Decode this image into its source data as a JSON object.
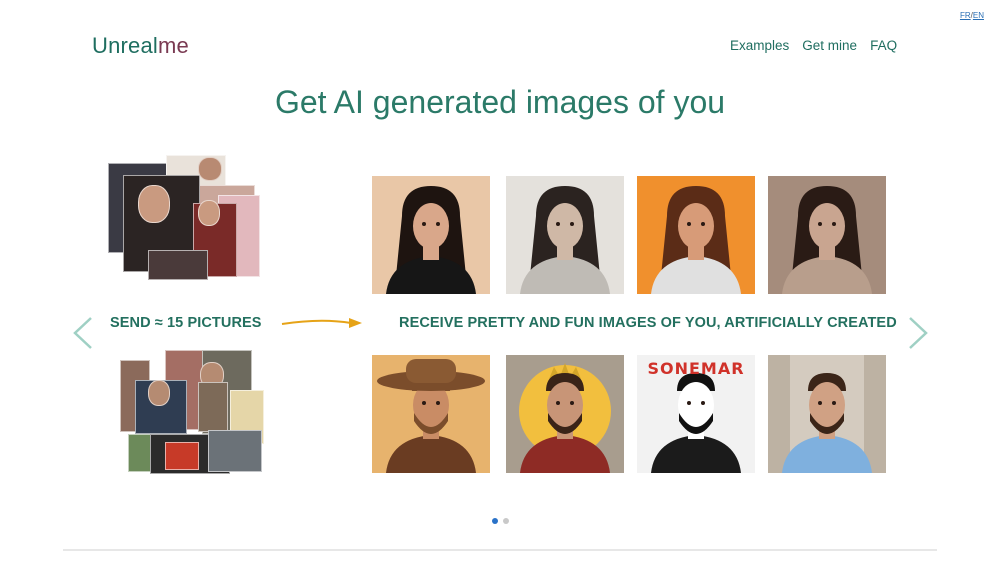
{
  "lang": {
    "fr": "FR",
    "sep": "/",
    "en": "EN"
  },
  "logo": {
    "part1": "Unreal",
    "part2": "me"
  },
  "nav": {
    "examples": "Examples",
    "get_mine": "Get mine",
    "faq": "FAQ"
  },
  "headline": "Get AI generated images of you",
  "carousel": {
    "send_label": "SEND ≈ 15 PICTURES",
    "receive_label": "RECEIVE PRETTY AND FUN IMAGES OF YOU, ARTIFICIALLY CREATED",
    "results_top": [
      {
        "style": "studio-portrait",
        "bg": "#e9c7a7",
        "hair": "#1e1410",
        "skin": "#d9a78a",
        "cloth": "#161616"
      },
      {
        "style": "android-portrait",
        "bg": "#e4e1dc",
        "hair": "#2b2320",
        "skin": "#cfb8a6",
        "cloth": "#bfbbb5"
      },
      {
        "style": "orange-portrait",
        "bg": "#f0902d",
        "hair": "#5b2c17",
        "skin": "#d79b78",
        "cloth": "#e0e0e0"
      },
      {
        "style": "painted-portrait",
        "bg": "#a58c7c",
        "hair": "#2a1b15",
        "skin": "#c9a590",
        "cloth": "#b89e8c"
      }
    ],
    "results_bottom": [
      {
        "style": "cowboy-portrait",
        "bg": "#e7b36d",
        "hair": "#7b4d2b",
        "skin": "#c98c65",
        "cloth": "#6a3c22"
      },
      {
        "style": "king-portrait",
        "bg": "#a89d8e",
        "hair": "#3a2418",
        "skin": "#c89577",
        "cloth": "#8e2b25"
      },
      {
        "style": "comic-portrait",
        "bg": "#f2f2f2",
        "hair": "#111111",
        "skin": "#ffffff",
        "cloth": "#1b1b1b",
        "caption": "SONEMAR"
      },
      {
        "style": "suit-portrait",
        "bg": "#d4cbbf",
        "hair": "#3b2518",
        "skin": "#d0a184",
        "cloth": "#7fb0de"
      }
    ]
  },
  "pagination": {
    "count": 2,
    "active": 1
  },
  "colors": {
    "accent": "#2b7a68",
    "arrow": "#e6a317",
    "chevron": "#9fd0c4"
  }
}
